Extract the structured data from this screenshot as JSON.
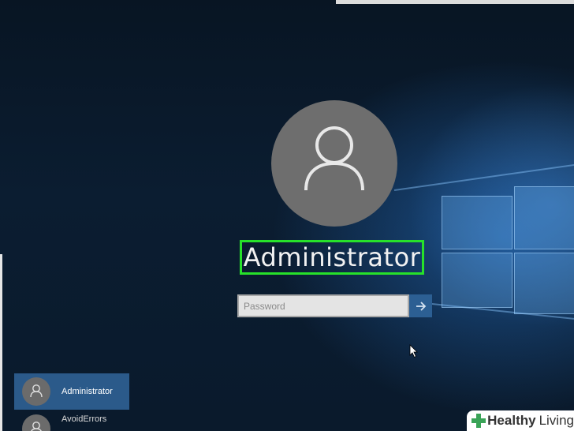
{
  "login": {
    "username": "Administrator",
    "password_placeholder": "Password",
    "submit_icon": "arrow-right-icon"
  },
  "user_list": [
    {
      "name": "Administrator",
      "selected": true
    },
    {
      "name": "AvoidErrors",
      "selected": false
    }
  ],
  "watermark": {
    "part1": "Healthy",
    "part2": "Living"
  },
  "colors": {
    "highlight": "#27e12a",
    "accent": "#2c5f93",
    "avatar": "#6e6e6e"
  }
}
